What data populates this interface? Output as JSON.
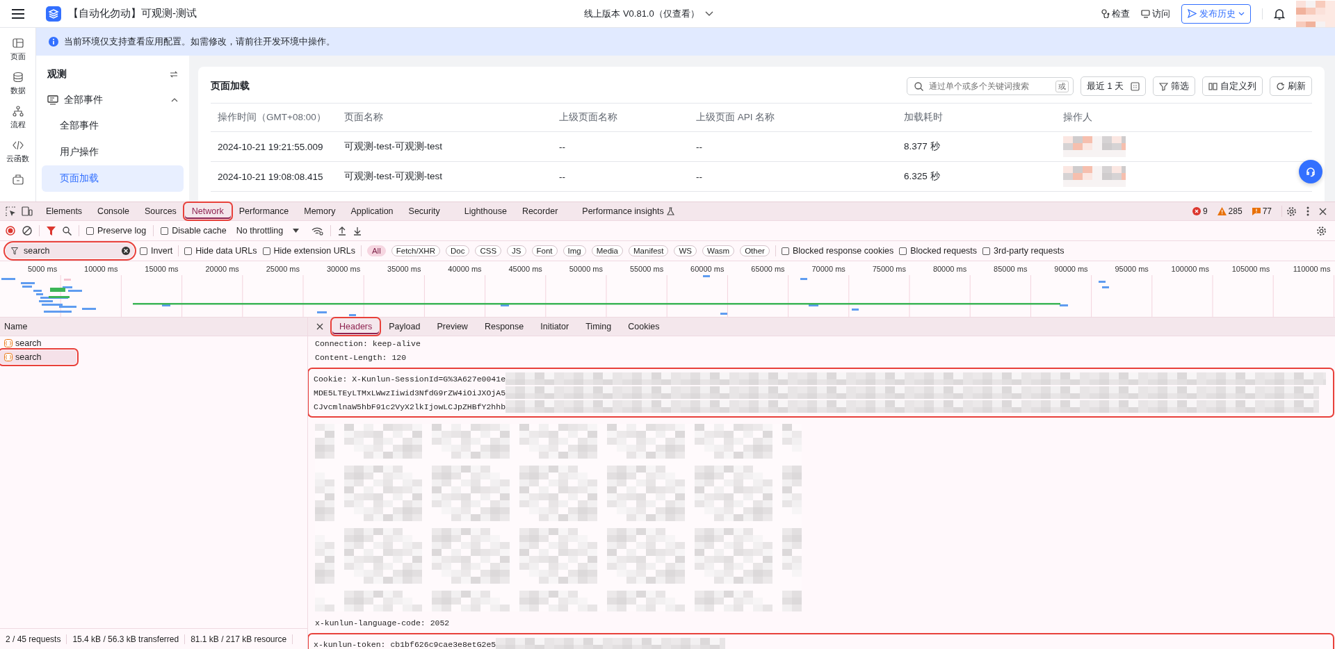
{
  "topbar": {
    "app_title": "【自动化勿动】可观测-测试",
    "version": "线上版本 V0.81.0（仅查看）",
    "actions": [
      "检查",
      "访问"
    ],
    "publish_button": "发布历史",
    "avatar_redacted": true
  },
  "rail": [
    {
      "label": "页面",
      "selected": false
    },
    {
      "label": "数据",
      "selected": false
    },
    {
      "label": "流程",
      "selected": false
    },
    {
      "label": "云函数",
      "selected": false
    }
  ],
  "notice": "当前环境仅支持查看应用配置。如需修改，请前往开发环境中操作。",
  "sidebar": {
    "title": "观测",
    "groups": [
      {
        "label": "全部事件",
        "expanded": true,
        "children": [
          {
            "label": "全部事件",
            "selected": false
          },
          {
            "label": "用户操作",
            "selected": false
          },
          {
            "label": "页面加载",
            "selected": true
          }
        ]
      }
    ]
  },
  "panel": {
    "title": "页面加载",
    "search": {
      "placeholder": "通过单个或多个关键词搜索",
      "key": "或"
    },
    "range": "最近 1 天",
    "buttons": [
      "筛选",
      "自定义列",
      "刷新"
    ],
    "table": {
      "columns": [
        "操作时间（GMT+08:00）",
        "页面名称",
        "上级页面名称",
        "上级页面 API 名称",
        "加载耗时",
        "操作人"
      ],
      "rows": [
        {
          "cells": [
            "2024-10-21 19:21:55.009",
            "可观测-test-可观测-test",
            "--",
            "--",
            "8.377 秒"
          ],
          "operator_redacted": true
        },
        {
          "cells": [
            "2024-10-21 19:08:08.415",
            "可观测-test-可观测-test",
            "--",
            "--",
            "6.325 秒"
          ],
          "operator_redacted": true
        }
      ]
    }
  },
  "devtools": {
    "tabs": [
      {
        "label": "Elements",
        "selected": false,
        "highlighted": false,
        "experimental": false
      },
      {
        "label": "Console",
        "selected": false,
        "highlighted": false,
        "experimental": false
      },
      {
        "label": "Sources",
        "selected": false,
        "highlighted": false,
        "experimental": false
      },
      {
        "label": "Network",
        "selected": true,
        "highlighted": true,
        "experimental": false
      },
      {
        "label": "Performance",
        "selected": false,
        "highlighted": false,
        "experimental": false
      },
      {
        "label": "Memory",
        "selected": false,
        "highlighted": false,
        "experimental": false
      },
      {
        "label": "Application",
        "selected": false,
        "highlighted": false,
        "experimental": false
      },
      {
        "label": "Security",
        "selected": false,
        "highlighted": false,
        "experimental": false
      },
      {
        "label": "Lighthouse",
        "selected": false,
        "highlighted": false,
        "experimental": false
      },
      {
        "label": "Recorder",
        "selected": false,
        "highlighted": false,
        "experimental": false
      },
      {
        "label": "Performance insights",
        "selected": false,
        "highlighted": false,
        "experimental": true
      }
    ],
    "counts": {
      "errors": "9",
      "warnings": "285",
      "issues": "77"
    },
    "toolbar": {
      "recording": true,
      "filter_active": true,
      "checks": [
        {
          "label": "Preserve log",
          "checked": false
        },
        {
          "label": "Disable cache",
          "checked": false
        }
      ],
      "throttling": "No throttling"
    },
    "filter": {
      "value": "search",
      "highlighted": true
    },
    "filter_checks": [
      {
        "label": "Invert",
        "checked": false
      },
      {
        "label": "Hide data URLs",
        "checked": false
      },
      {
        "label": "Hide extension URLs",
        "checked": false
      }
    ],
    "types": [
      {
        "label": "All",
        "selected": true
      },
      {
        "label": "Fetch/XHR",
        "selected": false
      },
      {
        "label": "Doc",
        "selected": false
      },
      {
        "label": "CSS",
        "selected": false
      },
      {
        "label": "JS",
        "selected": false
      },
      {
        "label": "Font",
        "selected": false
      },
      {
        "label": "Img",
        "selected": false
      },
      {
        "label": "Media",
        "selected": false
      },
      {
        "label": "Manifest",
        "selected": false
      },
      {
        "label": "WS",
        "selected": false
      },
      {
        "label": "Wasm",
        "selected": false
      },
      {
        "label": "Other",
        "selected": false
      }
    ],
    "extra_checks": [
      {
        "label": "Blocked response cookies",
        "checked": false
      },
      {
        "label": "Blocked requests",
        "checked": false
      },
      {
        "label": "3rd-party requests",
        "checked": false
      }
    ],
    "overview": {
      "ticks": [
        "5000 ms",
        "10000 ms",
        "15000 ms",
        "20000 ms",
        "25000 ms",
        "30000 ms",
        "35000 ms",
        "40000 ms",
        "45000 ms",
        "50000 ms",
        "55000 ms",
        "60000 ms",
        "65000 ms",
        "70000 ms",
        "75000 ms",
        "80000 ms",
        "85000 ms",
        "90000 ms",
        "95000 ms",
        "100000 ms",
        "105000 ms",
        "110000 ms"
      ]
    },
    "requests": {
      "column": "Name",
      "rows": [
        {
          "name": "search",
          "selected": false,
          "highlighted": false
        },
        {
          "name": "search",
          "selected": true,
          "highlighted": true
        }
      ]
    },
    "status": [
      "2 / 45 requests",
      "15.4 kB / 56.3 kB transferred",
      "81.1 kB / 217 kB resource"
    ],
    "detail": {
      "tabs": [
        {
          "label": "Headers",
          "selected": true,
          "highlighted": true
        },
        {
          "label": "Payload",
          "selected": false,
          "highlighted": false
        },
        {
          "label": "Preview",
          "selected": false,
          "highlighted": false
        },
        {
          "label": "Response",
          "selected": false,
          "highlighted": false
        },
        {
          "label": "Initiator",
          "selected": false,
          "highlighted": false
        },
        {
          "label": "Timing",
          "selected": false,
          "highlighted": false
        },
        {
          "label": "Cookies",
          "selected": false,
          "highlighted": false
        }
      ],
      "blocks": [
        {
          "kind": "text",
          "highlighted": false,
          "redacted": false,
          "lines": [
            "Connection: keep-alive",
            "Content-Length: 120"
          ]
        },
        {
          "kind": "text",
          "highlighted": true,
          "redacted": true,
          "lines": [
            "Cookie: X-Kunlun-SessionId=G%3A627e0041e",
            "MDE5LTEyLTMxLWwzIiwid3NfdG9rZW4iOiJXOjA5",
            "CJvcmlnaW5hbF91c2VyX2lkIjowLCJpZHBfY2hhb"
          ]
        },
        {
          "kind": "redacted",
          "highlighted": false,
          "redacted": true
        },
        {
          "kind": "text",
          "highlighted": false,
          "redacted": false,
          "lines": [
            "x-kunlun-language-code: 2052"
          ]
        },
        {
          "kind": "text",
          "highlighted": true,
          "redacted": true,
          "lines": [
            "x-kunlun-token: cb1bf626c9cae3e8etG2e5"
          ]
        }
      ]
    }
  }
}
